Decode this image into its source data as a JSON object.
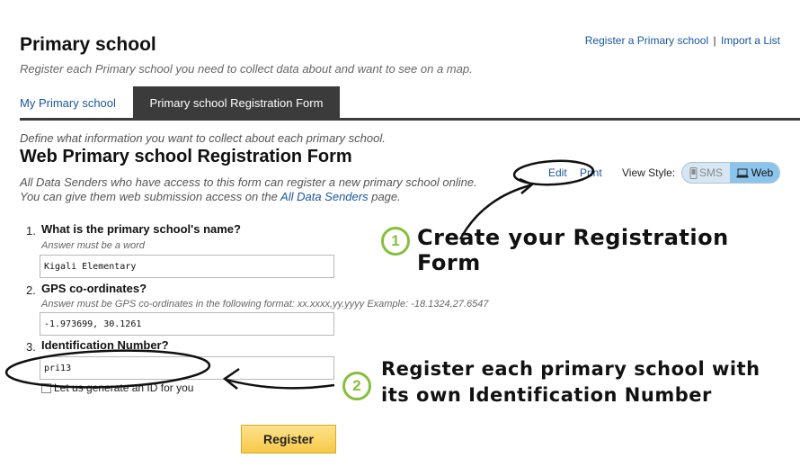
{
  "header": {
    "title": "Primary school",
    "subtitle": "Register each Primary school you need to collect data about and want to see on a map.",
    "links": {
      "register": "Register a Primary school",
      "separator": "|",
      "import": "Import a List"
    }
  },
  "tabs": [
    {
      "label": "My Primary school",
      "active": false
    },
    {
      "label": "Primary school Registration Form",
      "active": true
    }
  ],
  "form": {
    "intro": "Define what information you want to collect about each primary school.",
    "title": "Web Primary school Registration Form",
    "desc1": "All Data Senders who have access to this form can register a new primary school online.",
    "desc2_prefix": "You can give them web submission access on the",
    "desc2_link": "All Data Senders",
    "desc2_suffix": "page.",
    "edit_label": "Edit",
    "print_label": "Print",
    "view_style_label": "View Style:",
    "view_toggle": {
      "sms": "SMS",
      "web": "Web",
      "selected": "Web"
    },
    "questions": [
      {
        "num": "1.",
        "label": "What is the primary school's name?",
        "hint": "Answer must be a word",
        "value": "Kigali Elementary"
      },
      {
        "num": "2.",
        "label": "GPS co-ordinates?",
        "hint": "Answer must be GPS co-ordinates in the following format: xx.xxxx,yy.yyyy Example: -18.1324,27.6547",
        "value": "-1.973699, 30.1261"
      },
      {
        "num": "3.",
        "label": "Identification Number?",
        "hint": "",
        "value": "pri13"
      }
    ],
    "generate_id_label": "Let us generate an ID for you",
    "submit_label": "Register"
  },
  "annotations": [
    {
      "badge": "1",
      "text": "Create your Registration Form"
    },
    {
      "badge": "2",
      "line1": "Register each primary school with",
      "line2": "its own Identification Number"
    }
  ],
  "colors": {
    "accent_link": "#1b56a4",
    "tab_dark": "#3b3b3b",
    "badge_green": "#86bf3a",
    "button_yellow": "#f6c949"
  }
}
